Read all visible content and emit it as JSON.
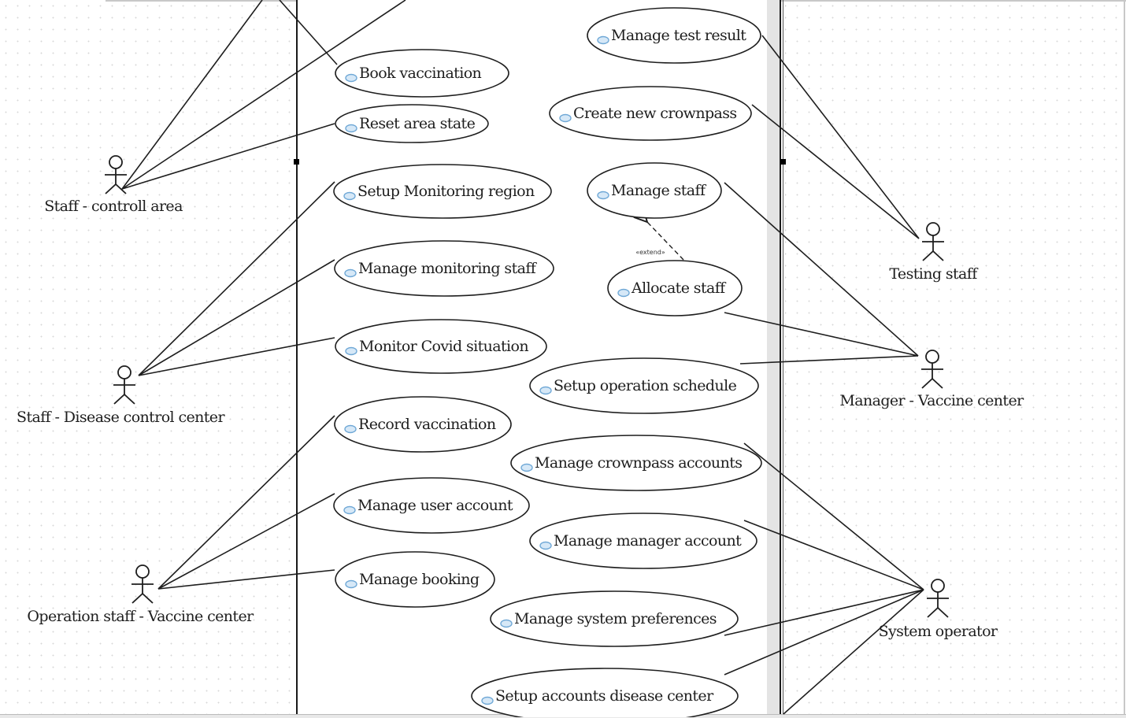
{
  "diagram": {
    "type": "use-case",
    "actors": [
      {
        "id": "a1",
        "label": "Staff - controll area"
      },
      {
        "id": "a2",
        "label": "Staff - Disease control center"
      },
      {
        "id": "a3",
        "label": "Operation staff - Vaccine center"
      },
      {
        "id": "a4",
        "label": "Testing staff"
      },
      {
        "id": "a5",
        "label": "Manager - Vaccine center"
      },
      {
        "id": "a6",
        "label": "System operator"
      }
    ],
    "use_cases": [
      {
        "id": "u1",
        "label": "Book vaccination"
      },
      {
        "id": "u2",
        "label": "Reset area state"
      },
      {
        "id": "u3",
        "label": "Setup Monitoring region"
      },
      {
        "id": "u4",
        "label": "Manage monitoring staff"
      },
      {
        "id": "u5",
        "label": "Monitor Covid situation"
      },
      {
        "id": "u6",
        "label": "Record vaccination"
      },
      {
        "id": "u7",
        "label": "Manage user account"
      },
      {
        "id": "u8",
        "label": "Manage booking"
      },
      {
        "id": "u9",
        "label": "Manage test result"
      },
      {
        "id": "u10",
        "label": "Create new crownpass"
      },
      {
        "id": "u11",
        "label": "Manage staff"
      },
      {
        "id": "u12",
        "label": "Allocate staff"
      },
      {
        "id": "u13",
        "label": "Setup operation schedule"
      },
      {
        "id": "u14",
        "label": "Manage crownpass accounts"
      },
      {
        "id": "u15",
        "label": "Manage manager account"
      },
      {
        "id": "u16",
        "label": "Manage system preferences"
      },
      {
        "id": "u17",
        "label": "Setup accounts disease center"
      }
    ],
    "relations": [
      {
        "from": "u12",
        "to": "u11",
        "type": "extend",
        "label": "«extend»"
      }
    ],
    "colors": {
      "line": "#1e1e1e",
      "use_case_icon": "#6fa8d6",
      "use_case_icon_fill": "#d6e8f7",
      "side_bar": "#e4e4e4"
    }
  }
}
